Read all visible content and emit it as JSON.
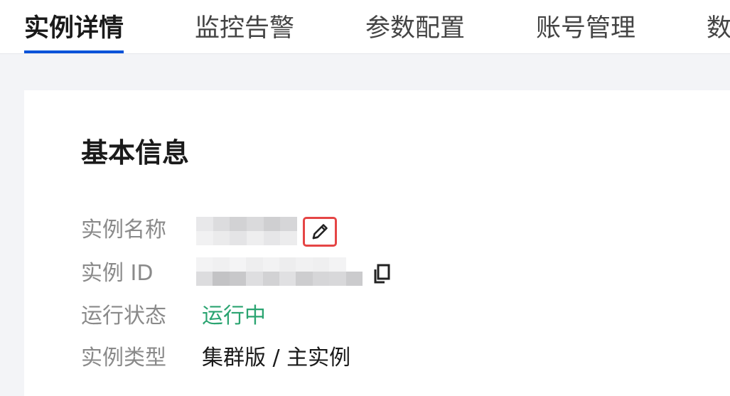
{
  "tabs": [
    {
      "label": "实例详情",
      "active": true
    },
    {
      "label": "监控告警",
      "active": false
    },
    {
      "label": "参数配置",
      "active": false
    },
    {
      "label": "账号管理",
      "active": false
    },
    {
      "label": "数",
      "active": false
    }
  ],
  "basic_info": {
    "title": "基本信息",
    "rows": {
      "name": {
        "label": "实例名称",
        "value_redacted": true
      },
      "id": {
        "label": "实例 ID",
        "value_redacted": true
      },
      "status": {
        "label": "运行状态",
        "value": "运行中"
      },
      "type": {
        "label": "实例类型",
        "value": "集群版 / 主实例"
      }
    }
  },
  "icons": {
    "edit": "pencil-icon",
    "copy": "copy-icon"
  },
  "colors": {
    "accent": "#0052d9",
    "status_running": "#2ba471",
    "highlight_border": "#e54545"
  }
}
